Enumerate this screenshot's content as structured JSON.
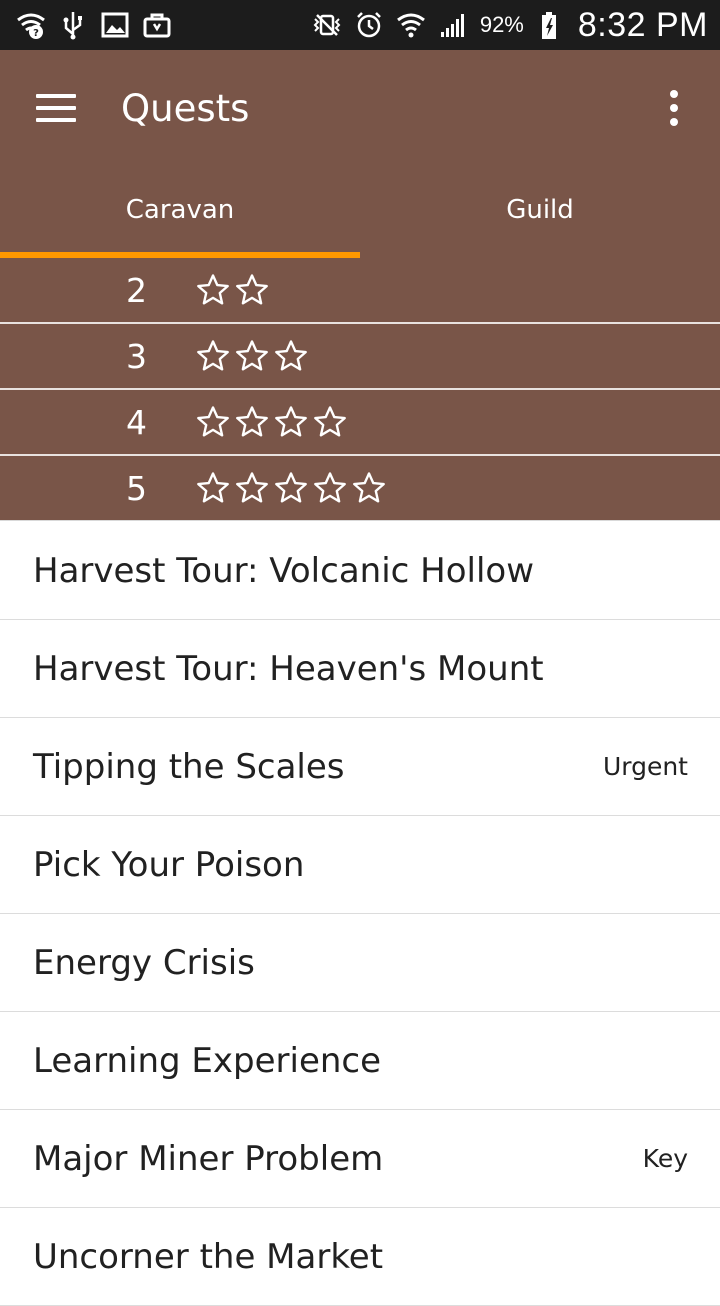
{
  "status_bar": {
    "icons_left": [
      "wifi-question-icon",
      "usb-icon",
      "image-icon",
      "briefcase-icon"
    ],
    "icons_right": [
      "nfc-vibrate-icon",
      "alarm-icon",
      "wifi-icon",
      "signal-icon",
      "battery-charging-icon"
    ],
    "battery": "92%",
    "time": "8:32 PM"
  },
  "app_bar": {
    "title": "Quests",
    "menu_icon": "hamburger-menu-icon",
    "overflow_icon": "more-vert-icon",
    "color": "#795548"
  },
  "tabs": [
    {
      "label": "Caravan",
      "active": true
    },
    {
      "label": "Guild",
      "active": false
    }
  ],
  "accent_color": "#ff9800",
  "ranks": [
    {
      "number": "2",
      "stars": 2
    },
    {
      "number": "3",
      "stars": 3
    },
    {
      "number": "4",
      "stars": 4
    },
    {
      "number": "5",
      "stars": 5
    }
  ],
  "quests": [
    {
      "name": "Harvest Tour: Volcanic Hollow",
      "tag": ""
    },
    {
      "name": "Harvest Tour: Heaven's Mount",
      "tag": ""
    },
    {
      "name": "Tipping the Scales",
      "tag": "Urgent"
    },
    {
      "name": "Pick Your Poison",
      "tag": ""
    },
    {
      "name": "Energy Crisis",
      "tag": ""
    },
    {
      "name": "Learning Experience",
      "tag": ""
    },
    {
      "name": "Major Miner Problem",
      "tag": "Key"
    },
    {
      "name": "Uncorner the Market",
      "tag": ""
    }
  ]
}
